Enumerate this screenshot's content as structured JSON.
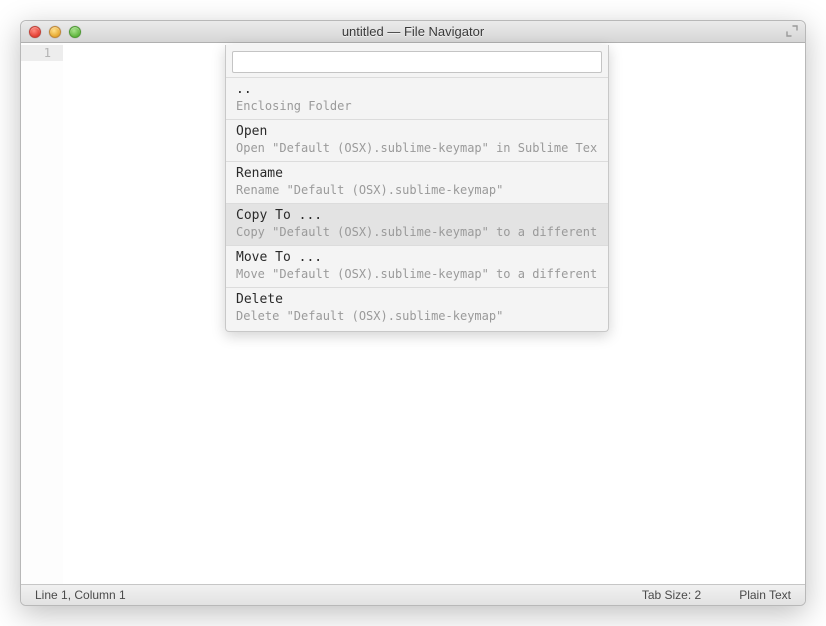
{
  "window": {
    "title": "untitled — File Navigator"
  },
  "gutter": {
    "line_number": "1"
  },
  "overlay": {
    "input_value": "",
    "items": [
      {
        "title": "..",
        "desc": "Enclosing Folder",
        "selected": false
      },
      {
        "title": "Open",
        "desc": "Open \"Default (OSX).sublime-keymap\" in Sublime Text",
        "selected": false
      },
      {
        "title": "Rename",
        "desc": "Rename \"Default (OSX).sublime-keymap\"",
        "selected": false
      },
      {
        "title": "Copy To ...",
        "desc": "Copy \"Default (OSX).sublime-keymap\" to a different l",
        "selected": true
      },
      {
        "title": "Move To ...",
        "desc": "Move \"Default (OSX).sublime-keymap\" to a different l",
        "selected": false
      },
      {
        "title": "Delete",
        "desc": "Delete \"Default (OSX).sublime-keymap\"",
        "selected": false
      }
    ]
  },
  "statusbar": {
    "position": "Line 1, Column 1",
    "tab_size": "Tab Size: 2",
    "syntax": "Plain Text"
  }
}
